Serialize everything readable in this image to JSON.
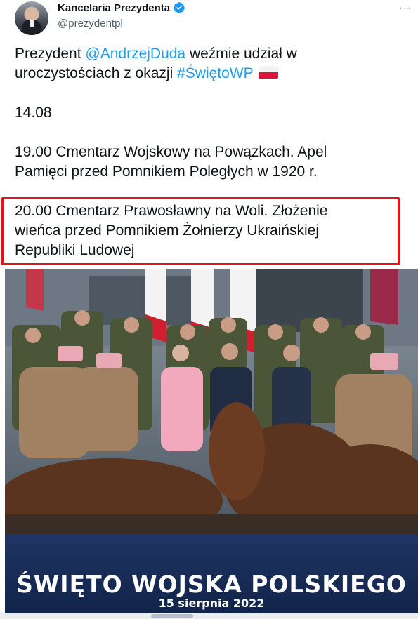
{
  "account": {
    "display_name": "Kancelaria Prezydenta",
    "handle": "@prezydentpl",
    "avatar_icon": "avatar-photo",
    "verified_icon": "verified-badge-icon",
    "more_icon": "more-options-icon",
    "more_label": "···"
  },
  "tweet": {
    "line1_prefix": "Prezydent ",
    "mention": "@AndrzejDuda",
    "line1_suffix": " weźmie udział w",
    "line2_prefix": "uroczystościach z okazji ",
    "hashtag": "#ŚwiętoWP",
    "date": "14.08",
    "event1_line1": "19.00 Cmentarz Wojskowy na Powązkach. Apel",
    "event1_line2": "Pamięci przed Pomnikiem Poległych w 1920 r.",
    "event2_line1": "20.00 Cmentarz Prawosławny na Woli. Złożenie",
    "event2_line2": "wieńca przed Pomnikiem Żołnierzy Ukraińskiej",
    "event2_line3": "Republiki Ludowej"
  },
  "image": {
    "banner_title": "ŚWIĘTO WOJSKA POLSKIEGO",
    "banner_date": "15 sierpnia 2022"
  },
  "colors": {
    "link": "#1d9bf0",
    "highlight_border": "#e6131b",
    "banner_bg": "#162a54",
    "verified": "#1d9bf0"
  }
}
